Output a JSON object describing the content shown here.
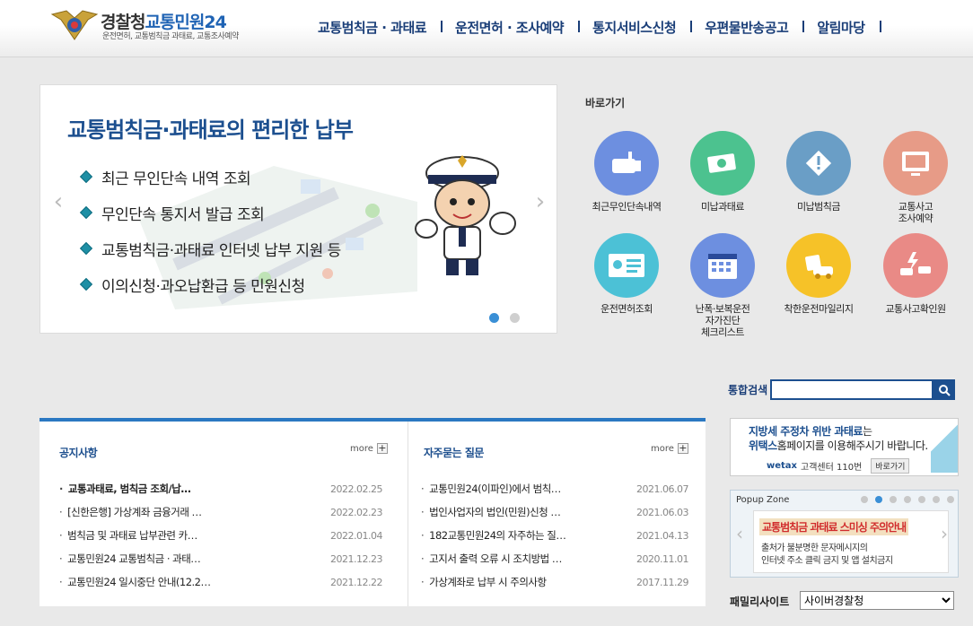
{
  "header": {
    "logo_main": "경찰청",
    "logo_sub": "교통민원24",
    "logo_tagline": "운전면허, 교통범칙금 과태료, 교통조사예약",
    "nav": [
      "교통범칙금 · 과태료",
      "운전면허 · 조사예약",
      "통지서비스신청",
      "우편물반송공고",
      "알림마당"
    ]
  },
  "slider": {
    "headline": "교통범칙금·과태료의 편리한 납부",
    "items": [
      "최근 무인단속 내역 조회",
      "무인단속 통지서 발급 조회",
      "교통범칙금·과태료 인터넷 납부 지원 등",
      "이의신청·과오납환급 등 민원신청"
    ],
    "prev_icon": "chevron-left-icon",
    "next_icon": "chevron-right-icon",
    "page_count": 2,
    "active_page": 1
  },
  "quick": {
    "title": "바로가기",
    "items": [
      {
        "label": "최근무인단속내역",
        "color": "#6d8fe0",
        "icon": "camera-icon"
      },
      {
        "label": "미납과태료",
        "color": "#4cc28f",
        "icon": "money-icon"
      },
      {
        "label": "미납범칙금",
        "color": "#6a9ec6",
        "icon": "warning-icon"
      },
      {
        "label": "교통사고\n조사예약",
        "color": "#e79b87",
        "icon": "monitor-icon"
      },
      {
        "label": "운전면허조회",
        "color": "#4cc1d6",
        "icon": "license-icon"
      },
      {
        "label": "난폭·보복운전\n자가진단\n체크리스트",
        "color": "#6d8fe0",
        "icon": "calendar-icon"
      },
      {
        "label": "착한운전마일리지",
        "color": "#f6c228",
        "icon": "mileage-icon"
      },
      {
        "label": "교통사고확인원",
        "color": "#e98a86",
        "icon": "crash-icon"
      }
    ]
  },
  "search": {
    "label": "통합검색",
    "value": "",
    "icon": "search-icon"
  },
  "notice": {
    "title": "공지사항",
    "more": "more",
    "rows": [
      {
        "title": "교통과태료, 범칙금 조회/납…",
        "date": "2022.02.25",
        "bold": true
      },
      {
        "title": "[신한은행] 가상계좌 금융거래 …",
        "date": "2022.02.23",
        "bold": false
      },
      {
        "title": "범칙금 및 과태료 납부관련 카…",
        "date": "2022.01.04",
        "bold": false
      },
      {
        "title": "교통민원24 교통범칙금 · 과태…",
        "date": "2021.12.23",
        "bold": false
      },
      {
        "title": "교통민원24 일시중단 안내(12.2…",
        "date": "2021.12.22",
        "bold": false
      }
    ]
  },
  "faq": {
    "title": "자주묻는 질문",
    "more": "more",
    "rows": [
      {
        "title": "교통민원24(이파인)에서 범칙…",
        "date": "2021.06.07"
      },
      {
        "title": "법인사업자의 법인(민원)신청 …",
        "date": "2021.06.03"
      },
      {
        "title": "182교통민원24의 자주하는 질…",
        "date": "2021.04.13"
      },
      {
        "title": "고지서 출력 오류 시 조치방법 …",
        "date": "2020.11.01"
      },
      {
        "title": "가상계좌로 납부 시 주의사항",
        "date": "2017.11.29"
      }
    ]
  },
  "wetax": {
    "line1_a": "지방세 주정차 위반 과태료",
    "line1_b": "는",
    "line2_a": "위택스",
    "line2_b": "홈페이지를 이용해주시기 바랍니다.",
    "brand": "wetax",
    "center": "고객센터 110번",
    "go": "바로가기"
  },
  "popup": {
    "title": "Popup Zone",
    "dot_count": 7,
    "active_dot": 1,
    "banner_title": "교통범칙금 과태료 스미싱 주의안내",
    "banner_line1": "출처가 불분명한 문자메시지의",
    "banner_line2": "인터넷 주소 클릭 금지 및 앱 설치금지"
  },
  "family": {
    "label": "패밀리사이트",
    "selected": "사이버경찰청"
  }
}
